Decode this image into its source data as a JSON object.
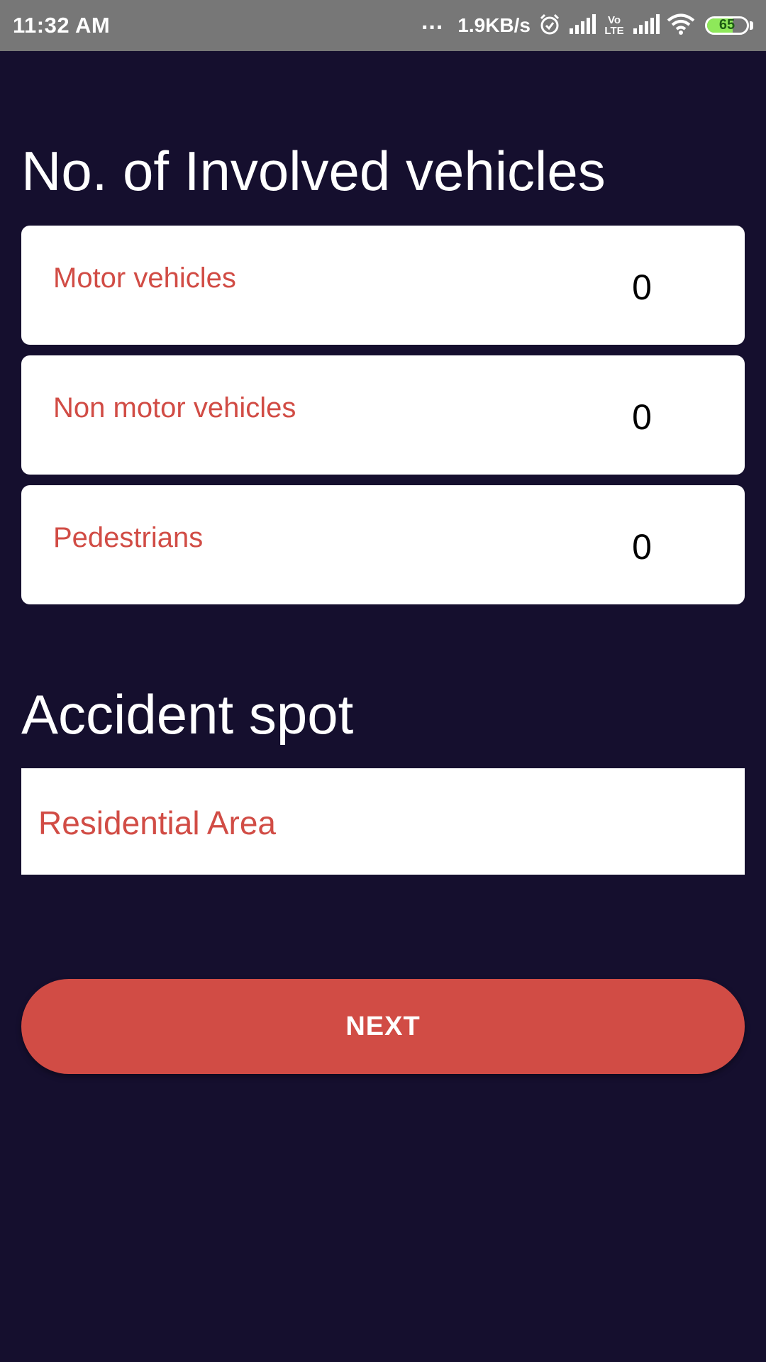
{
  "status_bar": {
    "time": "11:32 AM",
    "more_indicator": "...",
    "network_speed": "1.9KB/s",
    "volte_label_top": "Vo",
    "volte_label_bottom": "LTE",
    "battery_level": "65",
    "battery_fill_fraction": 0.65,
    "icons": [
      "alarm-icon",
      "signal-icon",
      "volte-icon",
      "signal-icon",
      "wifi-icon",
      "battery-icon"
    ]
  },
  "vehicles_section": {
    "title": "No. of Involved vehicles",
    "fields": [
      {
        "label": "Motor vehicles",
        "value": "0"
      },
      {
        "label": "Non motor vehicles",
        "value": "0"
      },
      {
        "label": "Pedestrians",
        "value": "0"
      }
    ]
  },
  "spot_section": {
    "title": "Accident spot",
    "selected": "Residential Area"
  },
  "actions": {
    "next_label": "NEXT"
  },
  "colors": {
    "background": "#150f2e",
    "status_bar": "#777777",
    "accent": "#d14c45",
    "card": "#ffffff",
    "battery_fill": "#8ee85a"
  }
}
